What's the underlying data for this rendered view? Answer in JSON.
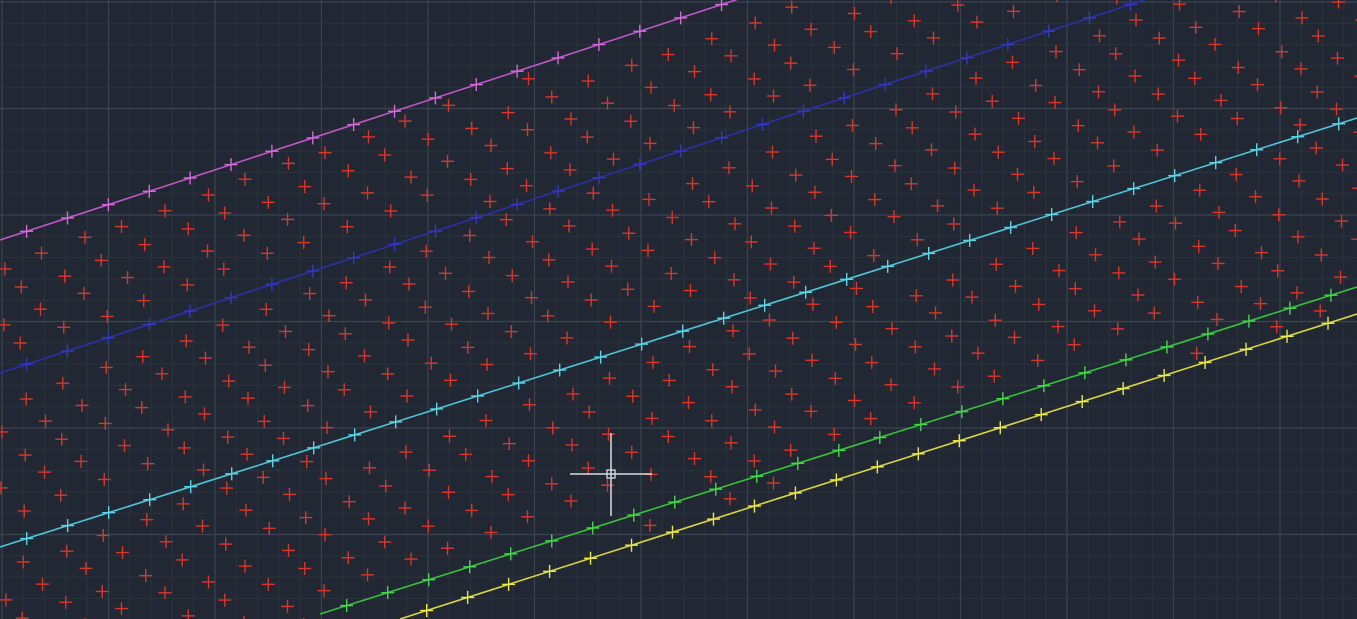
{
  "canvas": {
    "background": "#212833",
    "grid_minor_color": "#2b333e",
    "grid_major_color": "#3a4350"
  },
  "points": {
    "scatter_color": "#d8362b",
    "marker": "cross-icon"
  },
  "lines": [
    {
      "color": "#c156c8",
      "marker_color": "#d46ad8"
    },
    {
      "color": "#2b2fa8",
      "marker_color": "#3438c0"
    },
    {
      "color": "#4cc6d8",
      "marker_color": "#5ad4e4"
    },
    {
      "color": "#35c23a",
      "marker_color": "#46d84a"
    },
    {
      "color": "#d9d53a",
      "marker_color": "#ecea44"
    }
  ],
  "cursor": {
    "color": "#d9dde2",
    "icon": "crosshair-cursor-icon"
  }
}
